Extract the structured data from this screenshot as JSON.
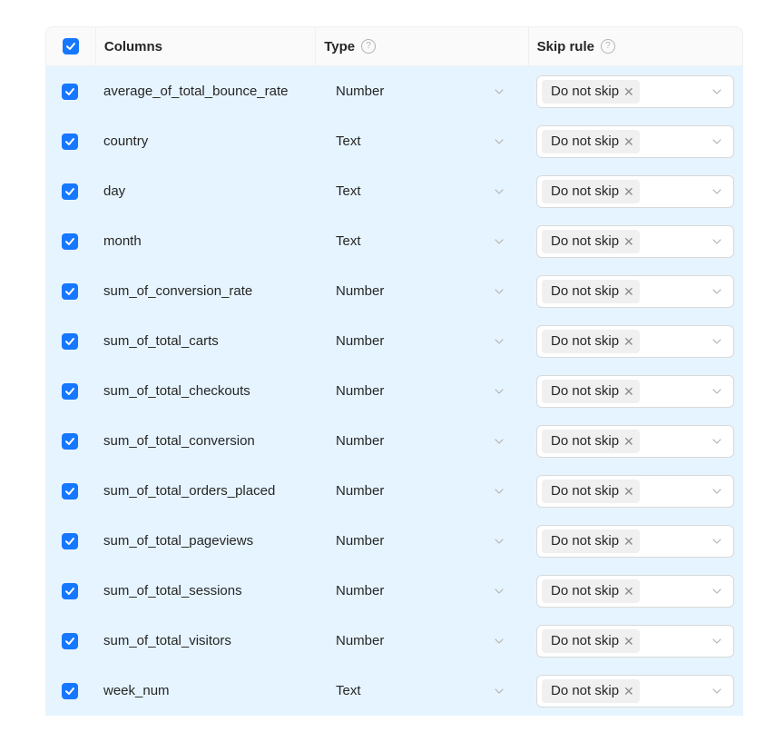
{
  "header": {
    "columns_label": "Columns",
    "type_label": "Type",
    "skip_label": "Skip rule",
    "help_glyph": "?"
  },
  "colors": {
    "accent": "#1677ff",
    "row_selected_bg": "#e6f4ff"
  },
  "rows": [
    {
      "name": "average_of_total_bounce_rate",
      "type": "Number",
      "skip": "Do not skip",
      "checked": true
    },
    {
      "name": "country",
      "type": "Text",
      "skip": "Do not skip",
      "checked": true
    },
    {
      "name": "day",
      "type": "Text",
      "skip": "Do not skip",
      "checked": true
    },
    {
      "name": "month",
      "type": "Text",
      "skip": "Do not skip",
      "checked": true
    },
    {
      "name": "sum_of_conversion_rate",
      "type": "Number",
      "skip": "Do not skip",
      "checked": true
    },
    {
      "name": "sum_of_total_carts",
      "type": "Number",
      "skip": "Do not skip",
      "checked": true
    },
    {
      "name": "sum_of_total_checkouts",
      "type": "Number",
      "skip": "Do not skip",
      "checked": true
    },
    {
      "name": "sum_of_total_conversion",
      "type": "Number",
      "skip": "Do not skip",
      "checked": true
    },
    {
      "name": "sum_of_total_orders_placed",
      "type": "Number",
      "skip": "Do not skip",
      "checked": true
    },
    {
      "name": "sum_of_total_pageviews",
      "type": "Number",
      "skip": "Do not skip",
      "checked": true
    },
    {
      "name": "sum_of_total_sessions",
      "type": "Number",
      "skip": "Do not skip",
      "checked": true
    },
    {
      "name": "sum_of_total_visitors",
      "type": "Number",
      "skip": "Do not skip",
      "checked": true
    },
    {
      "name": "week_num",
      "type": "Text",
      "skip": "Do not skip",
      "checked": true
    }
  ]
}
